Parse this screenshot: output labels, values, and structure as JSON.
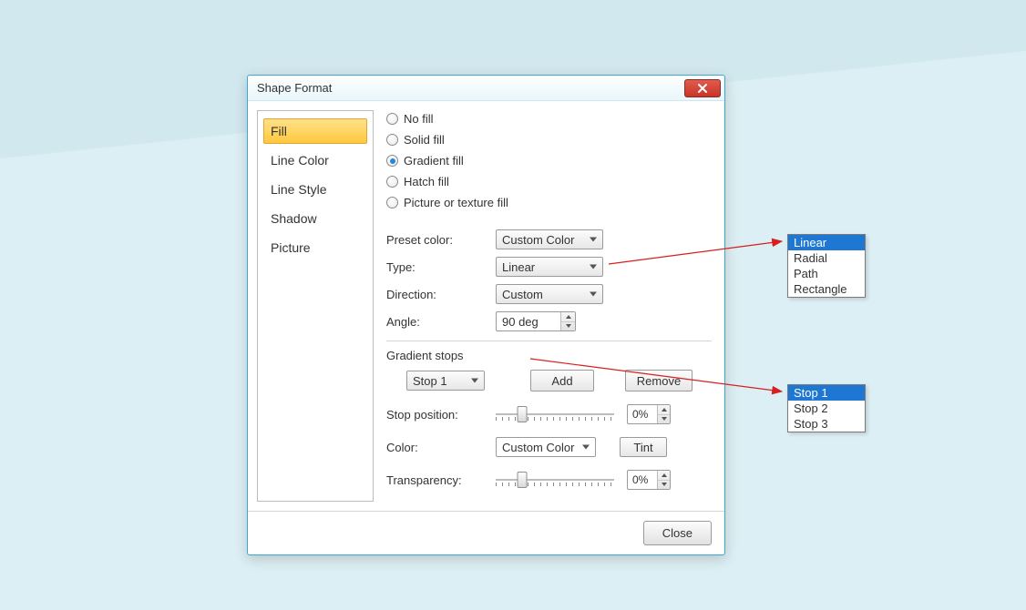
{
  "dialog": {
    "title": "Shape Format",
    "close_label": "Close"
  },
  "sidebar": {
    "items": [
      {
        "label": "Fill",
        "selected": true
      },
      {
        "label": "Line Color",
        "selected": false
      },
      {
        "label": "Line Style",
        "selected": false
      },
      {
        "label": "Shadow",
        "selected": false
      },
      {
        "label": "Picture",
        "selected": false
      }
    ]
  },
  "fill_options": {
    "items": [
      {
        "label": "No fill",
        "selected": false
      },
      {
        "label": "Solid fill",
        "selected": false
      },
      {
        "label": "Gradient fill",
        "selected": true
      },
      {
        "label": "Hatch fill",
        "selected": false
      },
      {
        "label": "Picture or texture fill",
        "selected": false
      }
    ]
  },
  "fields": {
    "preset_color": {
      "label": "Preset color:",
      "value": "Custom Color"
    },
    "type": {
      "label": "Type:",
      "value": "Linear"
    },
    "direction": {
      "label": "Direction:",
      "value": "Custom"
    },
    "angle": {
      "label": "Angle:",
      "value": "90 deg"
    },
    "gradient_stops_label": "Gradient stops",
    "stops_selector_value": "Stop 1",
    "add_label": "Add",
    "remove_label": "Remove",
    "stop_position": {
      "label": "Stop position:",
      "value": "0%"
    },
    "color": {
      "label": "Color:",
      "value": "Custom Color"
    },
    "tint_label": "Tint",
    "transparency": {
      "label": "Transparency:",
      "value": "0%"
    }
  },
  "popups": {
    "type_options": [
      "Linear",
      "Radial",
      "Path",
      "Rectangle"
    ],
    "type_selected_index": 0,
    "stops_options": [
      "Stop 1",
      "Stop 2",
      "Stop 3"
    ],
    "stops_selected_index": 0
  }
}
